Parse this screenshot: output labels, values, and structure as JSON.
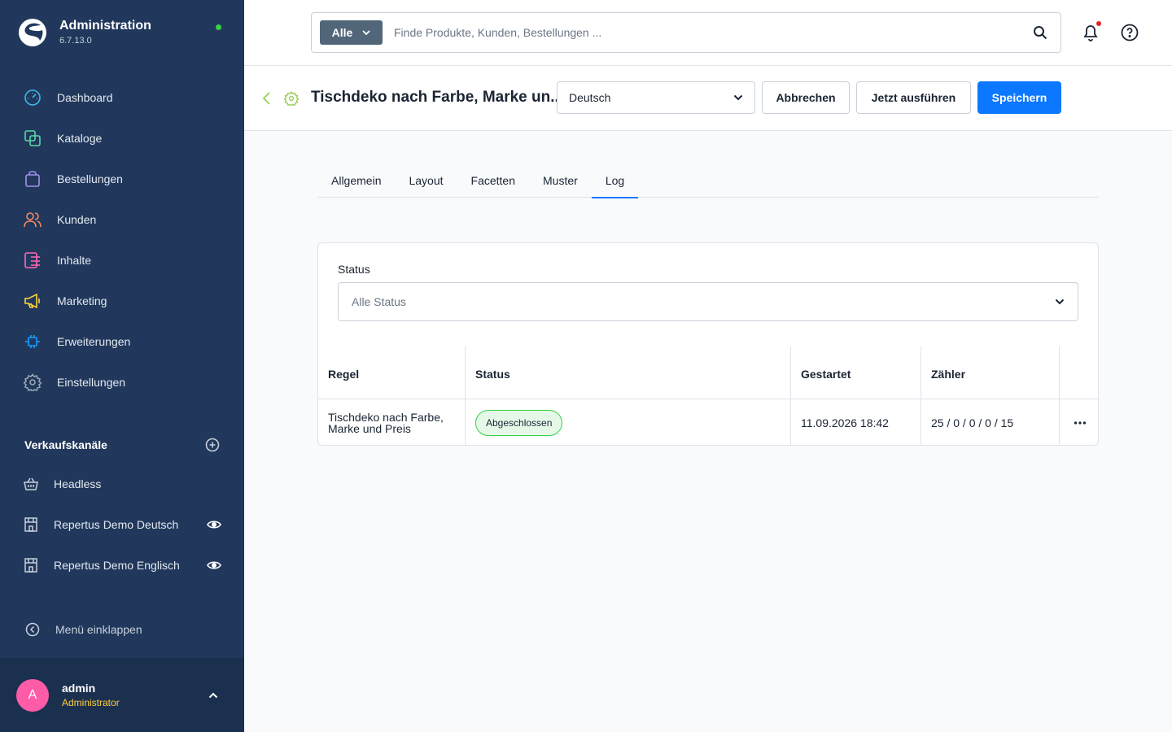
{
  "app": {
    "title": "Administration",
    "version": "6.7.13.0"
  },
  "colors": {
    "sidebar": "#21385c",
    "accent": "#0b78ff",
    "online": "#37d046",
    "success_bg": "#e6f9e9"
  },
  "nav": [
    {
      "label": "Dashboard",
      "icon": "gauge-icon",
      "color": "#3db7e8"
    },
    {
      "label": "Kataloge",
      "icon": "catalog-icon",
      "color": "#57d9a3"
    },
    {
      "label": "Bestellungen",
      "icon": "shopping-bag-icon",
      "color": "#a092f0"
    },
    {
      "label": "Kunden",
      "icon": "users-icon",
      "color": "#f88962"
    },
    {
      "label": "Inhalte",
      "icon": "content-icon",
      "color": "#ff68b4"
    },
    {
      "label": "Marketing",
      "icon": "megaphone-icon",
      "color": "#ffd33d"
    },
    {
      "label": "Erweiterungen",
      "icon": "plug-icon",
      "color": "#189eff"
    },
    {
      "label": "Einstellungen",
      "icon": "gear-icon",
      "color": "#9aa8b5"
    }
  ],
  "sales_channels": {
    "title": "Verkaufskanäle",
    "items": [
      {
        "label": "Headless",
        "icon": "basket-icon",
        "has_eye": false
      },
      {
        "label": "Repertus Demo Deutsch",
        "icon": "storefront-icon",
        "has_eye": true
      },
      {
        "label": "Repertus Demo Englisch",
        "icon": "storefront-icon",
        "has_eye": true
      }
    ]
  },
  "collapse_label": "Menü einklappen",
  "user": {
    "initial": "A",
    "name": "admin",
    "role": "Administrator"
  },
  "search": {
    "type": "Alle",
    "placeholder": "Finde Produkte, Kunden, Bestellungen ..."
  },
  "page": {
    "title": "Tischdeko nach Farbe, Marke un...",
    "language": "Deutsch",
    "cancel_label": "Abbrechen",
    "run_label": "Jetzt ausführen",
    "save_label": "Speichern"
  },
  "tabs": [
    {
      "label": "Allgemein",
      "active": false
    },
    {
      "label": "Layout",
      "active": false
    },
    {
      "label": "Facetten",
      "active": false
    },
    {
      "label": "Muster",
      "active": false
    },
    {
      "label": "Log",
      "active": true
    }
  ],
  "filter": {
    "label": "Status",
    "value": "Alle Status"
  },
  "table": {
    "columns": [
      "Regel",
      "Status",
      "Gestartet",
      "Zähler"
    ],
    "rows": [
      {
        "rule": "Tischdeko nach Farbe, Marke und Preis",
        "status": "Abgeschlossen",
        "started": "11.09.2026 18:42",
        "counter": "25 / 0 / 0 / 0 / 15"
      }
    ]
  }
}
